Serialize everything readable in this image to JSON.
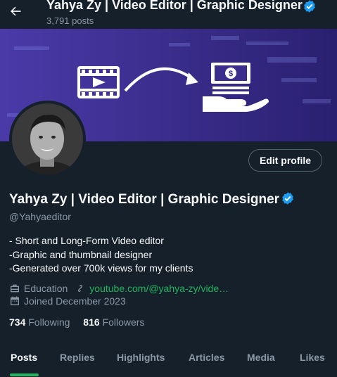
{
  "header": {
    "title": "Yahya Zy | Video Editor | Graphic Designer",
    "posts_count": "3,791 posts"
  },
  "profile": {
    "name": "Yahya Zy | Video Editor | Graphic Designer",
    "handle": "@Yahyaeditor",
    "edit_label": "Edit profile",
    "bio_lines": [
      "- Short and Long-Form Video editor",
      "-Graphic and thumbnail designer",
      "-Generated over 700k views for my clients"
    ],
    "category": "Education",
    "website": "youtube.com/@yahya-zy/vide…",
    "joined": "Joined December 2023",
    "following_count": "734",
    "following_label": "Following",
    "followers_count": "816",
    "followers_label": "Followers"
  },
  "tabs": [
    {
      "label": "Posts"
    },
    {
      "label": "Replies"
    },
    {
      "label": "Highlights"
    },
    {
      "label": "Articles"
    },
    {
      "label": "Media"
    },
    {
      "label": "Likes"
    }
  ],
  "colors": {
    "background": "#15202b",
    "accent": "#1fb45e",
    "verified": "#1d9bf0",
    "banner": "#3b2f8f"
  }
}
